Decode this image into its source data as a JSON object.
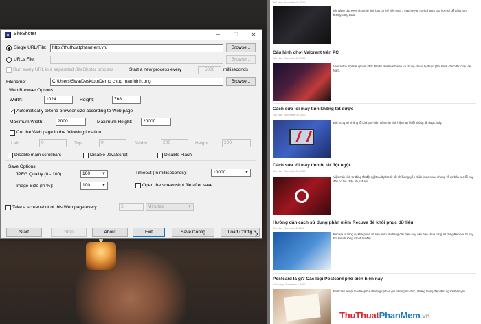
{
  "dialog": {
    "title": "SiteShoter",
    "window_controls": {
      "minimize": "─",
      "maximize": "☐",
      "close": "✕"
    },
    "single_url_label": "Single URL/File:",
    "single_url_value": "http://thuthuatphanmem.vn/",
    "browse_label": "Browse...",
    "urls_file_label": "URLs File:",
    "run_every_label": "Run every URL in a separated SiteShoter process",
    "start_new_process_label": "Start a new process every",
    "process_interval": "5000",
    "milliseconds_label": "milliseconds",
    "filename_label": "Filename:",
    "filename_value": "C:\\Users\\Swa\\Desktop\\Demo chup man hinh.png",
    "web_browser_options_title": "Web Browser Options",
    "width_label": "Width:",
    "width_value": "1024",
    "height_label": "Height:",
    "height_value": "768",
    "auto_extend_label": "Automatically extend browser size according to Web page",
    "max_width_label": "Maximum Width:",
    "max_width_value": "2000",
    "max_height_label": "Maximum Height:",
    "max_height_value": "20000",
    "cut_label": "Cut the Web page in the following location:",
    "left_label": "Left:",
    "left_value": "0",
    "top_label": "Top:",
    "top_value": "0",
    "cut_width_label": "Width:",
    "cut_width_value": "200",
    "cut_height_label": "Height:",
    "cut_height_value": "200",
    "disable_scrollbars_label": "Disable main scrollbars",
    "disable_js_label": "Disable JavaScript",
    "disable_flash_label": "Disable Flash",
    "save_options_title": "Save Options",
    "jpeg_quality_label": "JPEG Quality (0 - 100):",
    "jpeg_quality_value": "100",
    "image_size_label": "Image Size (In %):",
    "image_size_value": "100",
    "timeout_label": "Timeout (In milliseconds):",
    "timeout_value": "10000",
    "open_after_save_label": "Open the screenshot file after save",
    "take_every_label": "Take a screenshot of this Web page every",
    "take_every_value": "5",
    "take_every_unit": "Minutes",
    "buttons": {
      "start": "Start",
      "stop": "Stop",
      "about": "About",
      "exit": "Exit",
      "save_config": "Save Config",
      "load_config": "Load Config"
    }
  },
  "website": {
    "articles": [
      {
        "title": "",
        "meta": "Win Hoa · November 06, 2020",
        "excerpt": "Khi nâng cấp RAM cho máy tính bạn có thể việc mua 1 thanh RAM mới có BUS cao hơn sẽ dễ dàng hơn không cùng BUS."
      },
      {
        "title": "Cấu hình chơi Valorant trên PC",
        "meta": "Win Hoa · November 06, 2020",
        "excerpt": "Valorant là một siêu phẩm FPS đến từ nhà Riot Game và chúng chuẩn bị được phát hành chính thức tại Việt Nam."
      },
      {
        "title": "Cách sửa lỗi máy tính không tắt được",
        "meta": "Thu Hoa · November 06, 2020",
        "excerpt": "Bởi trong số những lỗi khá phổ biến trên máy tính hiện nay là lỗi không tắt được máy."
      },
      {
        "title": "Cách sửa lỗi máy tính bị tắt đột ngột",
        "meta": "Thu Hoa · November 06, 2020",
        "excerpt": "Việc máy tính tự động tắt đột ngột xuất phát từ rất nhiều nguyên nhân khác nhau nhưng về cơ bản các lỗi này đều có thể khắc phục được."
      },
      {
        "title": "Hướng dẫn cách sử dụng phần mềm Recuva để khôi phục dữ liệu",
        "meta": "Thu Hoa · November 6, 2020",
        "excerpt": "Recuva là công cụ khôi phục dữ liệu miễn phí hàng đầu hiện nay, nếu bạn chưa từng sử dụng Recuva thì hãy tìm hiểu hướng dẫn dưới đây."
      },
      {
        "title": "Postcard là gì? Các loại Postcard phổ biến hiện nay",
        "meta": "Vu Hoang · November 6, 2020",
        "excerpt": "Postcard là một loại thiệp bưu thiếp giúp bạn gửi những lời chúc, những thông điệp đến người thân yêu."
      }
    ],
    "brand": {
      "part1": "ThuThuat",
      "part2": "PhanMem",
      "part3": ".vn"
    }
  }
}
